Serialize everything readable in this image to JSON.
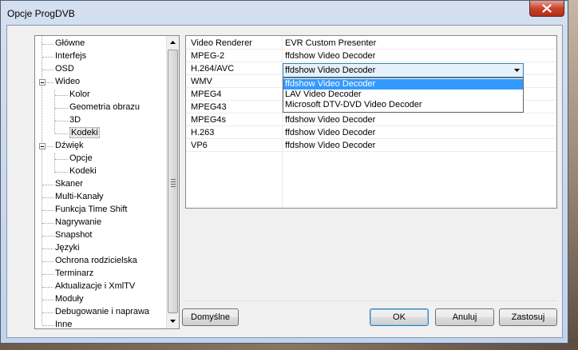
{
  "window": {
    "title": "Opcje ProgDVB"
  },
  "tree": {
    "items": [
      {
        "label": "Główne",
        "level": 0
      },
      {
        "label": "Interfejs",
        "level": 0
      },
      {
        "label": "OSD",
        "level": 0
      },
      {
        "label": "Wideo",
        "level": 0,
        "expanded": true
      },
      {
        "label": "Kolor",
        "level": 1
      },
      {
        "label": "Geometria obrazu",
        "level": 1
      },
      {
        "label": "3D",
        "level": 1
      },
      {
        "label": "Kodeki",
        "level": 1,
        "selected": true
      },
      {
        "label": "Dźwięk",
        "level": 0,
        "expanded": true
      },
      {
        "label": "Opcje",
        "level": 1
      },
      {
        "label": "Kodeki",
        "level": 1
      },
      {
        "label": "Skaner",
        "level": 0
      },
      {
        "label": "Multi-Kanały",
        "level": 0
      },
      {
        "label": "Funkcja Time Shift",
        "level": 0
      },
      {
        "label": "Nagrywanie",
        "level": 0
      },
      {
        "label": "Snapshot",
        "level": 0
      },
      {
        "label": "Języki",
        "level": 0
      },
      {
        "label": "Ochrona rodzicielska",
        "level": 0
      },
      {
        "label": "Terminarz",
        "level": 0
      },
      {
        "label": "Aktualizacje i XmlTV",
        "level": 0
      },
      {
        "label": "Moduły",
        "level": 0
      },
      {
        "label": "Debugowanie i naprawa",
        "level": 0
      },
      {
        "label": "Inne",
        "level": 0
      }
    ]
  },
  "grid": {
    "rows": [
      {
        "name": "Video Renderer",
        "value": "EVR Custom Presenter"
      },
      {
        "name": "MPEG-2",
        "value": "ffdshow Video Decoder"
      },
      {
        "name": "H.264/AVC",
        "value": "ffdshow Video Decoder"
      },
      {
        "name": "WMV",
        "value": "ffdshow Video Decoder"
      },
      {
        "name": "MPEG4",
        "value": "ffdshow Video Decoder"
      },
      {
        "name": "MPEG43",
        "value": "ffdshow Video Decoder"
      },
      {
        "name": "MPEG4s",
        "value": "ffdshow Video Decoder"
      },
      {
        "name": "H.263",
        "value": "ffdshow Video Decoder"
      },
      {
        "name": "VP6",
        "value": "ffdshow Video Decoder"
      }
    ],
    "combo": {
      "value": "ffdshow Video Decoder",
      "options": [
        "ffdshow Video Decoder",
        "LAV Video Decoder",
        "Microsoft DTV-DVD Video Decoder"
      ]
    }
  },
  "buttons": {
    "defaults": "Domyślne",
    "ok": "OK",
    "cancel": "Anuluj",
    "apply": "Zastosuj"
  },
  "colors": {
    "selection": "#3399ff",
    "close": "#c9432c"
  }
}
